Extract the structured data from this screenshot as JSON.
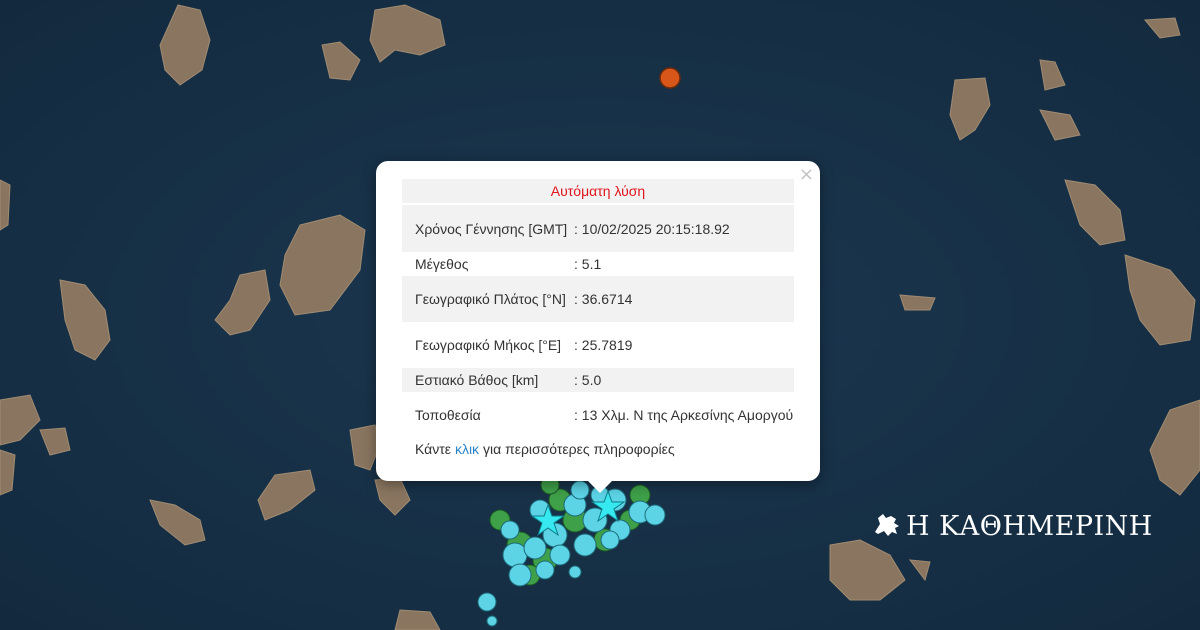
{
  "map": {
    "description_icon": "seismic-event-map",
    "colors": {
      "sea": "#18324a",
      "land": "#8a7660",
      "event_recent": "#5cd4e6",
      "event_older": "#3fa04a",
      "event_orange": "#d9561b",
      "star": "#36e8f0"
    }
  },
  "popup": {
    "close_label": "×",
    "title": "Αυτόματη λύση",
    "rows": [
      {
        "label": "Χρόνος Γέννησης [GMT]",
        "value": ": 10/02/2025 20:15:18.92"
      },
      {
        "label": "Μέγεθος",
        "value": ": 5.1"
      },
      {
        "label": "Γεωγραφικό Πλάτος [°N]",
        "value": ": 36.6714"
      },
      {
        "label": "Γεωγραφικό Μήκος [°E]",
        "value": ": 25.7819"
      },
      {
        "label": "Εστιακό Βάθος [km]",
        "value": ": 5.0"
      },
      {
        "label": "Τοποθεσία",
        "value": ": 13 Χλμ. Ν της Αρκεσίνης Αμοργού"
      }
    ],
    "more_prefix": "Κάντε",
    "more_link": "κλικ",
    "more_suffix": "για περισσότερες πληροφορίες"
  },
  "logo": {
    "text": "Η ΚΑΘΗΜΕΡΙΝΗ",
    "icon": "horse-rider-logo-icon"
  }
}
